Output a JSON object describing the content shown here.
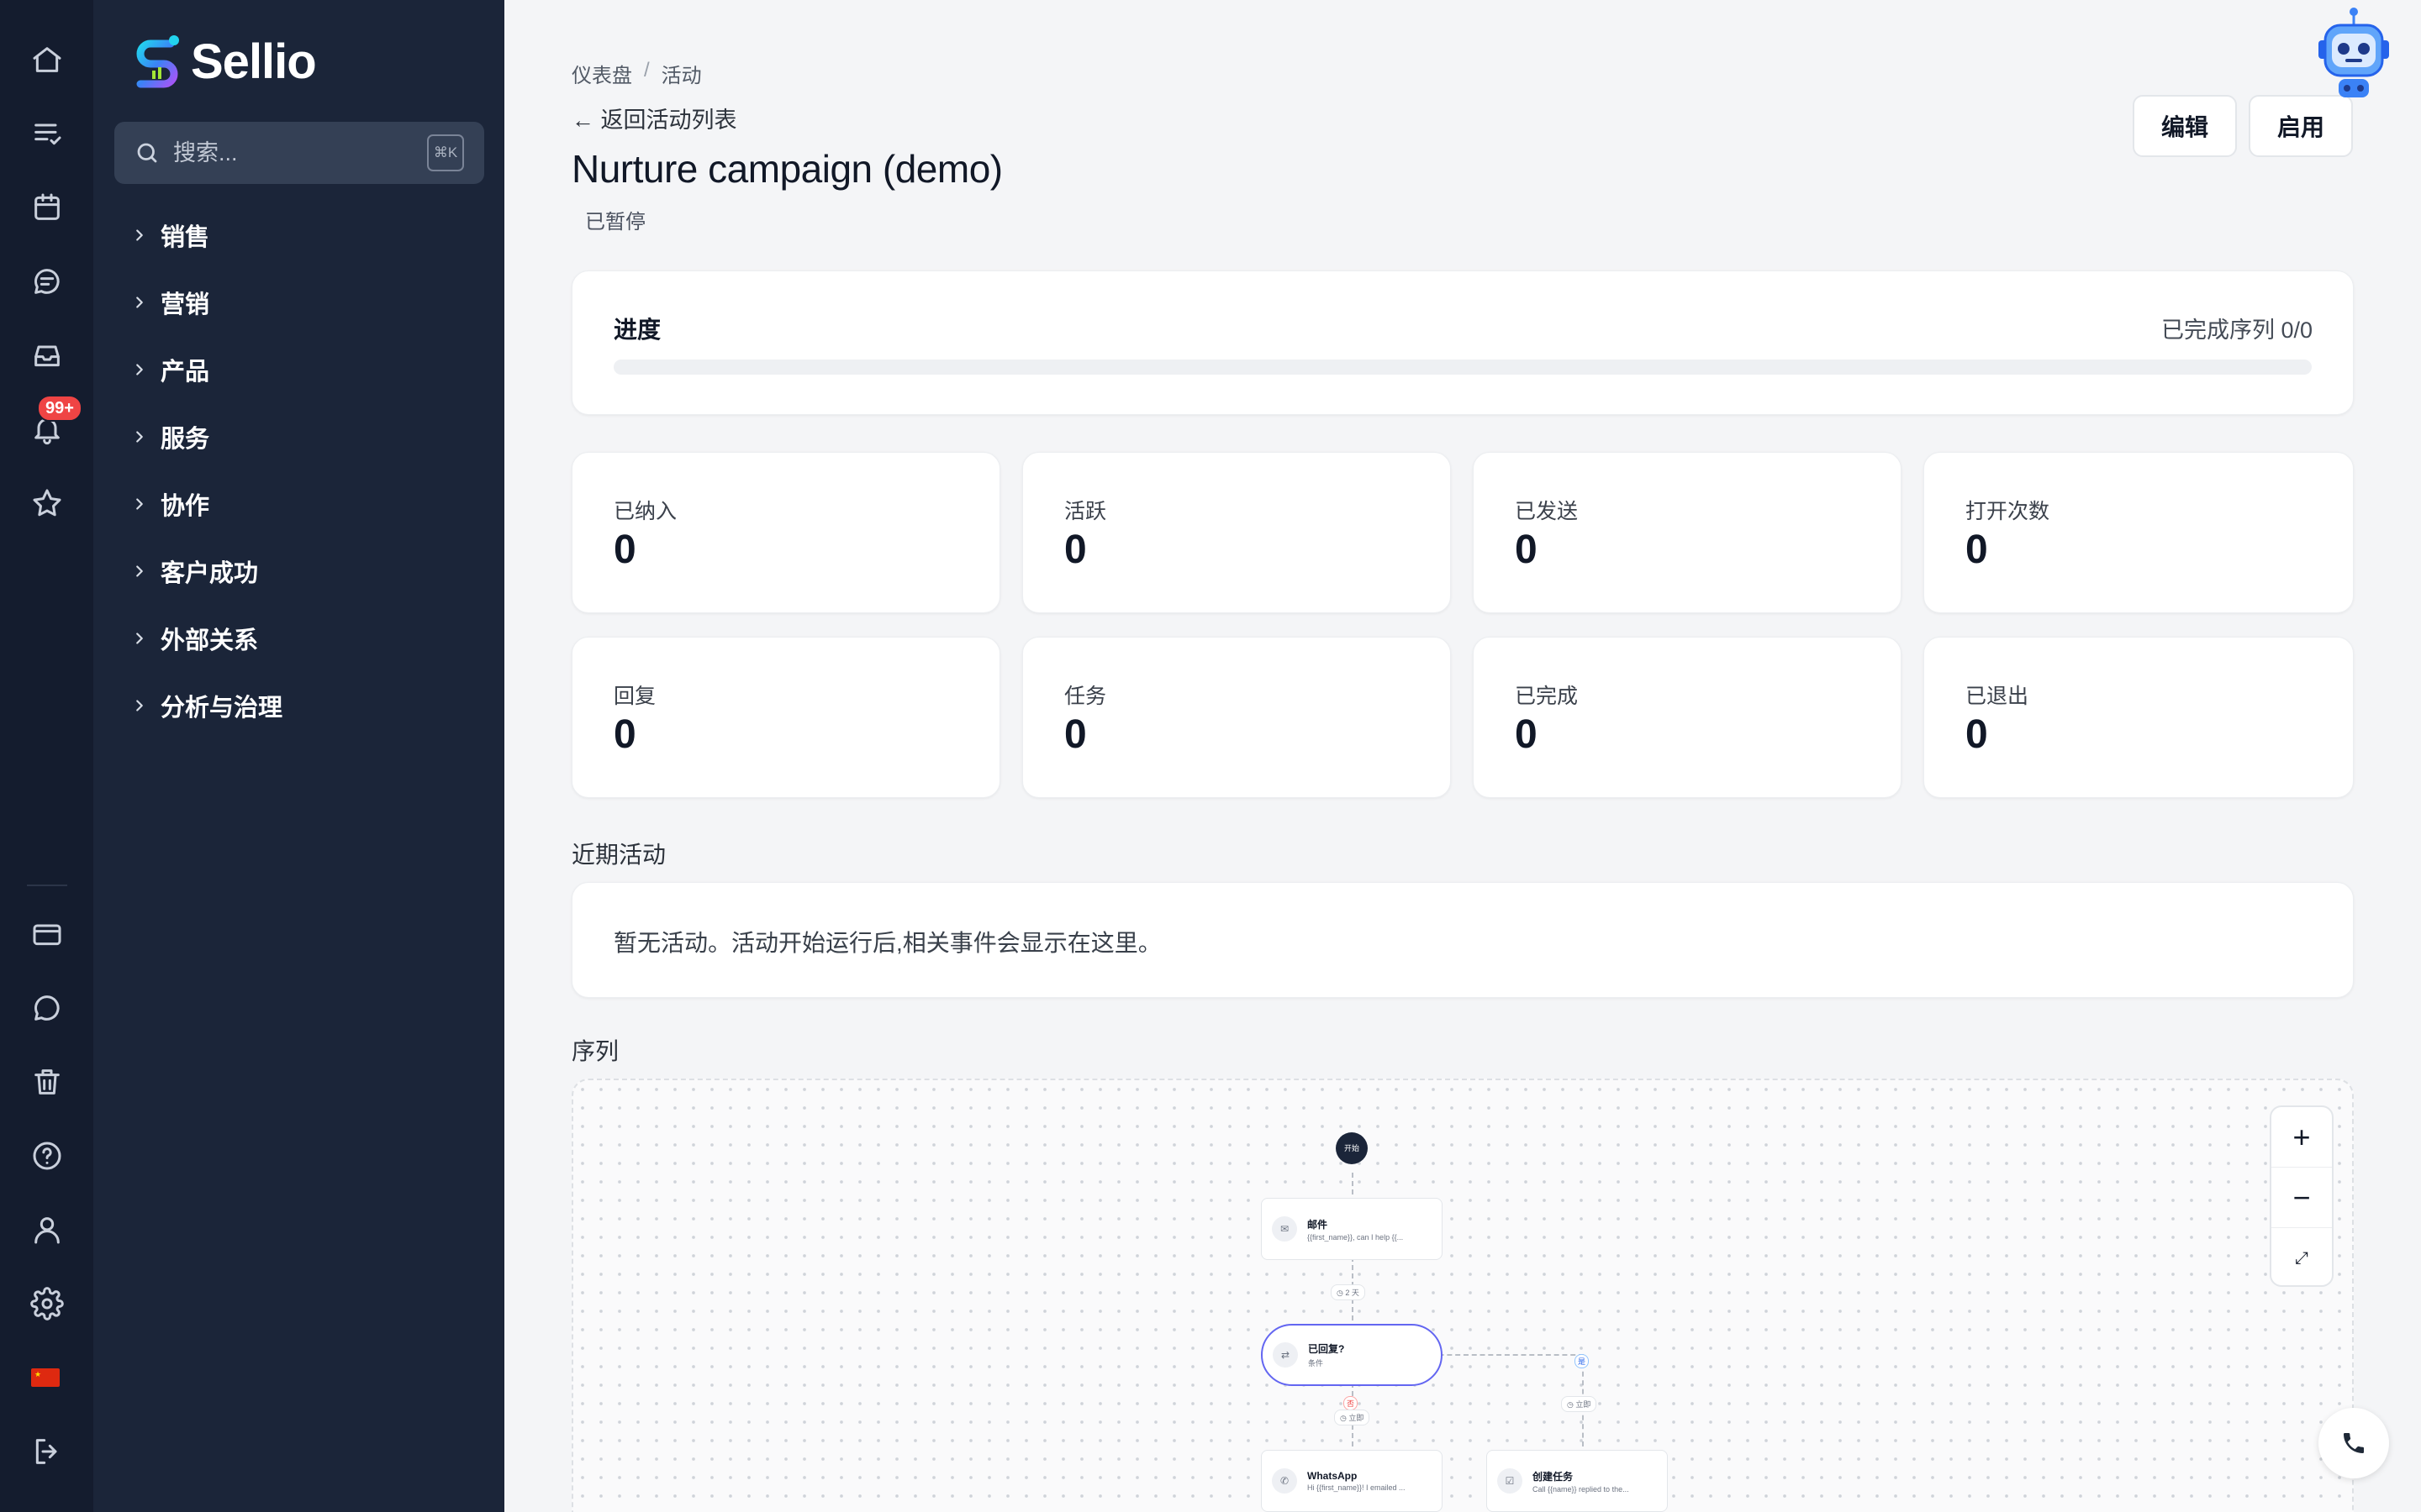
{
  "app": {
    "logo_text": "Sellio",
    "colors": {
      "rail_bg": "#141c2e",
      "sidebar_bg": "#1b2539",
      "page_bg": "#f4f5f7",
      "badge": "#ef4444"
    }
  },
  "rail": {
    "icons": [
      "home-icon",
      "tasks-icon",
      "calendar-icon",
      "chat-icon",
      "inbox-icon",
      "bell-icon",
      "star-icon",
      "card-icon",
      "message-icon",
      "trash-icon",
      "help-icon",
      "user-icon",
      "gear-icon",
      "flag-icon",
      "logout-icon"
    ],
    "notification_badge": "99+"
  },
  "sidebar": {
    "search_placeholder": "搜索...",
    "search_shortcut": "⌘K",
    "items": [
      {
        "label": "销售"
      },
      {
        "label": "营销"
      },
      {
        "label": "产品"
      },
      {
        "label": "服务"
      },
      {
        "label": "协作"
      },
      {
        "label": "客户成功"
      },
      {
        "label": "外部关系"
      },
      {
        "label": "分析与治理"
      }
    ]
  },
  "header": {
    "breadcrumb": [
      "仪表盘",
      "活动"
    ],
    "breadcrumb_sep": "/",
    "back_link": "← 返回活动列表",
    "title": "Nurture campaign (demo)",
    "status": "已暂停",
    "edit_label": "编辑",
    "enable_label": "启用"
  },
  "progress": {
    "label": "进度",
    "summary": "已完成序列 0/0",
    "fraction": 0
  },
  "stats": [
    {
      "label": "已纳入",
      "value": "0"
    },
    {
      "label": "活跃",
      "value": "0"
    },
    {
      "label": "已发送",
      "value": "0"
    },
    {
      "label": "打开次数",
      "value": "0"
    },
    {
      "label": "回复",
      "value": "0"
    },
    {
      "label": "任务",
      "value": "0"
    },
    {
      "label": "已完成",
      "value": "0"
    },
    {
      "label": "已退出",
      "value": "0"
    }
  ],
  "recent": {
    "title": "近期活动",
    "empty": "暂无活动。活动开始运行后,相关事件会显示在这里。"
  },
  "sequence": {
    "title": "序列",
    "zoom_in": "+",
    "zoom_out": "−",
    "fit": "⤢",
    "start_label": "开始",
    "nodes": [
      {
        "title": "邮件",
        "subtitle": "{{first_name}}, can I help {{..."
      },
      {
        "title": "已回复?",
        "subtitle": "条件"
      },
      {
        "title": "WhatsApp",
        "subtitle": "Hi {{first_name}}! I emailed ..."
      },
      {
        "title": "创建任务",
        "subtitle": "Call {{name}} replied to the..."
      }
    ],
    "delays": [
      "2 天",
      "立即",
      "立即"
    ],
    "branch_no": "否",
    "branch_yes": "是"
  }
}
